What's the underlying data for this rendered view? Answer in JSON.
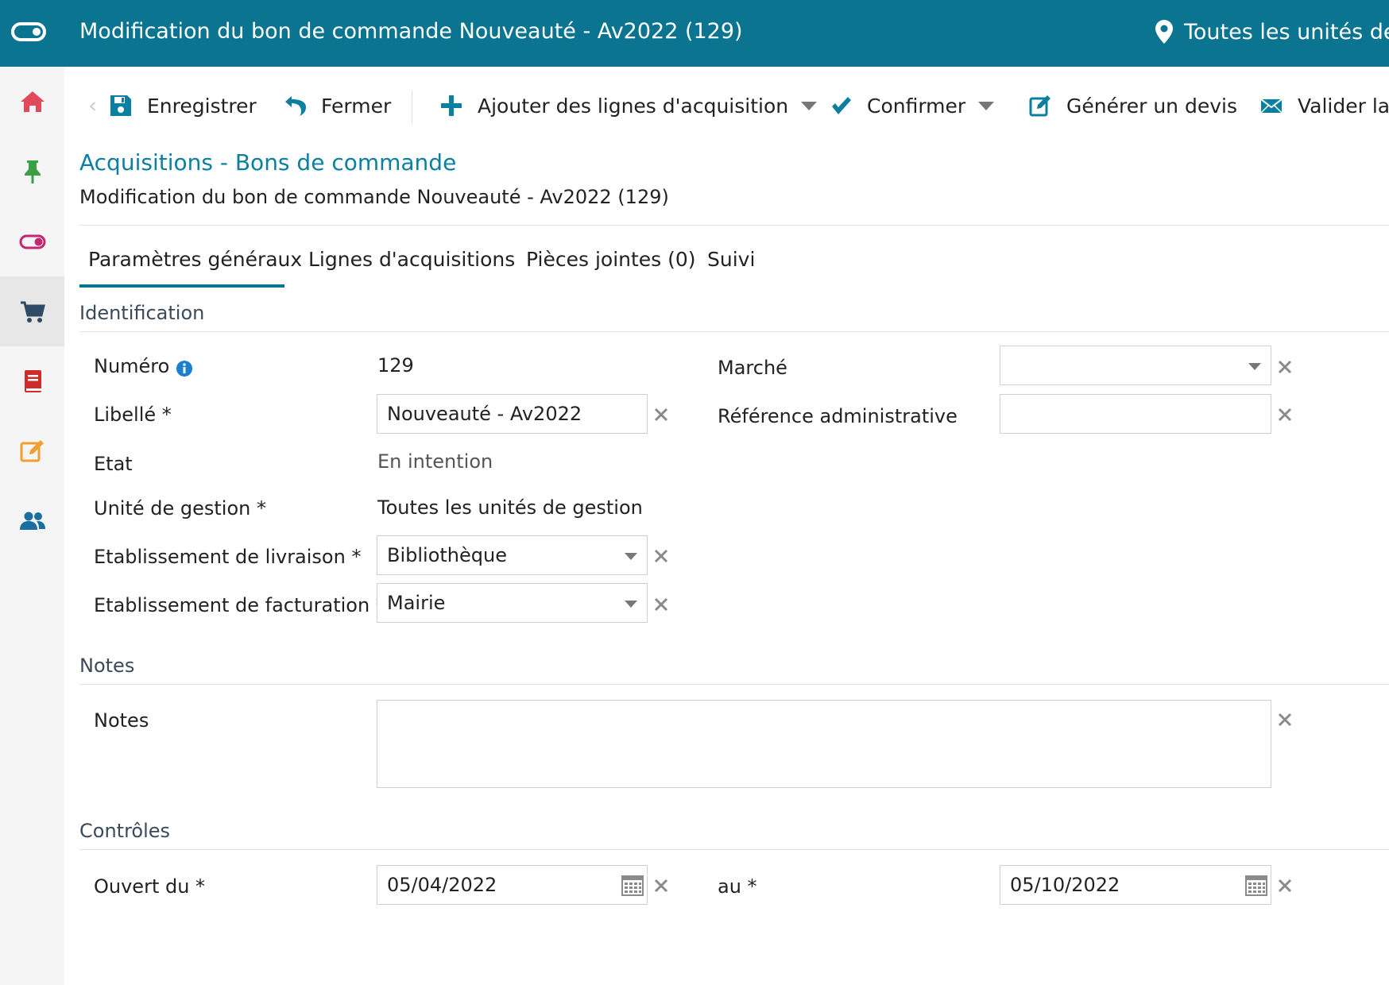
{
  "topbar": {
    "title": "Modification du bon de commande Nouveauté - Av2022 (129)",
    "unit": "Toutes les unités de g",
    "color": "#0a7491"
  },
  "sidebar": {
    "items": [
      {
        "icon": "home-icon",
        "color": "#e24a5a"
      },
      {
        "icon": "pin-icon",
        "color": "#3aa045"
      },
      {
        "icon": "toggle-icon",
        "color": "#c8256f"
      },
      {
        "icon": "cart-icon",
        "color": "#2e4a66",
        "active": true
      },
      {
        "icon": "book-icon",
        "color": "#cf2b2b"
      },
      {
        "icon": "edit-icon",
        "color": "#f0a030"
      },
      {
        "icon": "users-icon",
        "color": "#1a6fa0"
      }
    ]
  },
  "toolbar": {
    "save": "Enregistrer",
    "close": "Fermer",
    "add_lines": "Ajouter des lignes d'acquisition",
    "confirm": "Confirmer",
    "quote": "Générer un devis",
    "validate": "Valider la c"
  },
  "breadcrumb": "Acquisitions - Bons de commande",
  "subtitle": "Modification du bon de commande Nouveauté - Av2022 (129)",
  "tabs": [
    "Paramètres généraux",
    "Lignes d'acquisitions",
    "Pièces jointes (0)",
    "Suivi"
  ],
  "sections": {
    "identification": "Identification",
    "notes": "Notes",
    "controls": "Contrôles"
  },
  "fields": {
    "numero": {
      "label": "Numéro",
      "value": "129"
    },
    "libelle": {
      "label": "Libellé *",
      "value": "Nouveauté - Av2022"
    },
    "etat": {
      "label": "Etat",
      "value": "En intention"
    },
    "unite": {
      "label": "Unité de gestion *",
      "value": "Toutes les unités de gestion"
    },
    "livraison": {
      "label": "Etablissement de livraison *",
      "value": "Bibliothèque"
    },
    "facturation": {
      "label": "Etablissement de facturation *",
      "value": "Mairie"
    },
    "marche": {
      "label": "Marché",
      "value": ""
    },
    "reference": {
      "label": "Référence administrative",
      "value": ""
    },
    "notes": {
      "label": "Notes",
      "value": ""
    },
    "ouvert_du": {
      "label": "Ouvert du *",
      "value": "05/04/2022"
    },
    "au": {
      "label": "au *",
      "value": "05/10/2022"
    }
  }
}
